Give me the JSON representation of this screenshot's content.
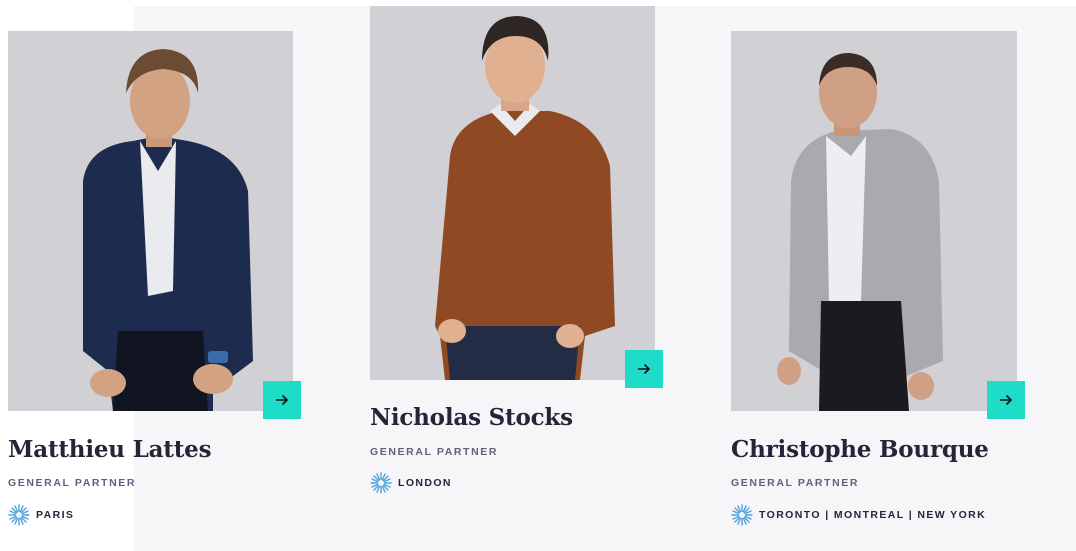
{
  "team": [
    {
      "name": "Matthieu Lattes",
      "role": "GENERAL PARTNER",
      "location": "PARIS",
      "photo_icon": "portrait-photo",
      "arrow_icon": "arrow-right-icon"
    },
    {
      "name": "Nicholas Stocks",
      "role": "GENERAL PARTNER",
      "location": "LONDON",
      "photo_icon": "portrait-photo",
      "arrow_icon": "arrow-right-icon"
    },
    {
      "name": "Christophe Bourque",
      "role": "GENERAL PARTNER",
      "location": "TORONTO | MONTREAL | NEW YORK",
      "photo_icon": "portrait-photo",
      "arrow_icon": "arrow-right-icon"
    }
  ],
  "colors": {
    "accent": "#1fdcc8",
    "photo_bg": "#d1d0d4",
    "name_text": "#242638",
    "role_text": "#5d6479",
    "location_icon": "#4aa3e0"
  }
}
